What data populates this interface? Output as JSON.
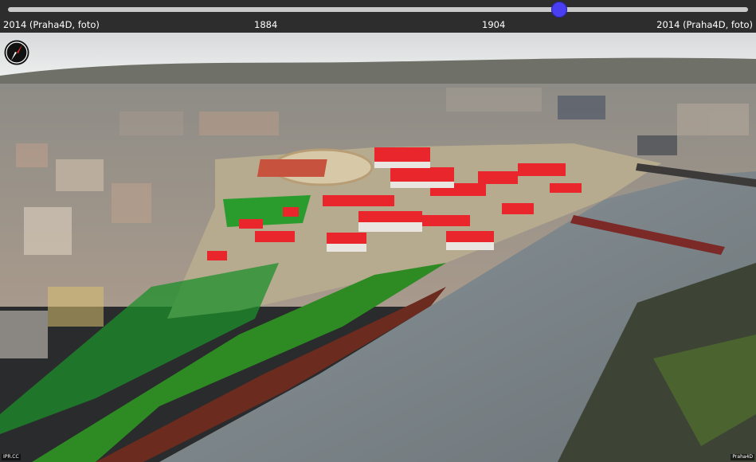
{
  "timeline": {
    "labels": [
      "2014 (Praha4D, foto)",
      "1884",
      "1904",
      "2014 (Praha4D, foto)"
    ],
    "current_position": 0.745
  },
  "compass": {
    "icon": "compass-icon"
  },
  "footer": {
    "left_tag": "IPR.CC",
    "right_tag": "Praha4D"
  },
  "colors": {
    "slider_thumb": "#4a3ff0",
    "slider_track": "#c9c9c9",
    "topbar": "#2d2d2d",
    "model_roof": "#e8262c",
    "model_grass": "#1e9b2a",
    "river": "#7a8488"
  }
}
